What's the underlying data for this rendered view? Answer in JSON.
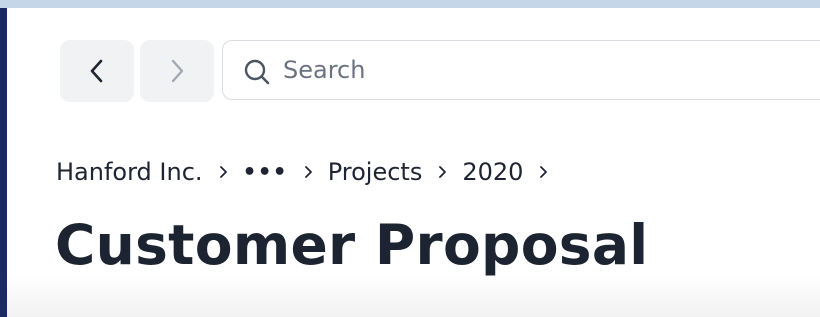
{
  "navigation": {
    "back_icon": "chevron-left-icon",
    "forward_icon": "chevron-right-icon"
  },
  "search": {
    "icon": "search-icon",
    "placeholder": "Search",
    "value": ""
  },
  "breadcrumb": {
    "items": [
      "Hanford Inc.",
      "•••",
      "Projects",
      "2020"
    ],
    "separator_icon": "chevron-right-icon"
  },
  "page": {
    "title": "Customer Proposal"
  },
  "colors": {
    "top_strip": "#c5d6e9",
    "left_rail": "#1b2a63",
    "text": "#1e2432",
    "button_bg": "#f1f2f4"
  }
}
